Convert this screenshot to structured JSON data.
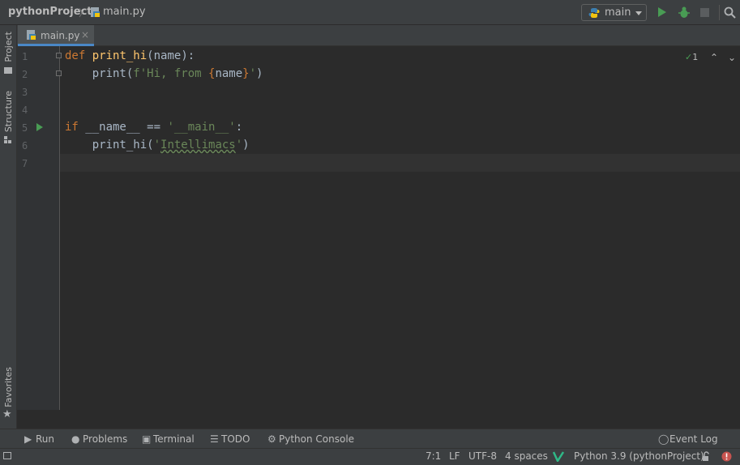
{
  "nav": {
    "project": "pythonProject",
    "file": "main.py",
    "run_config": "main"
  },
  "left_strip": {
    "project": "Project",
    "structure": "Structure",
    "favorites": "Favorites"
  },
  "tabs": [
    {
      "label": "main.py",
      "close": "×"
    }
  ],
  "editor": {
    "line_numbers": [
      "1",
      "2",
      "3",
      "4",
      "5",
      "6",
      "7"
    ],
    "lines": {
      "l1": {
        "kw": "def",
        "fn": "print_hi",
        "rest": "(name):"
      },
      "l2": {
        "indent": "    ",
        "call": "print(",
        "s1": "f'Hi, from ",
        "b1": "{",
        "var": "name",
        "b2": "}",
        "s2": "'",
        "end": ")"
      },
      "l5": {
        "kw": "if",
        "mid": " __name__ == ",
        "str": "'__main__'",
        "end": ":"
      },
      "l6": {
        "indent": "    ",
        "call": "print_hi(",
        "q1": "'",
        "word": "Intellimacs",
        "q2": "'",
        "end": ")"
      }
    },
    "inspection_count": "1"
  },
  "tool_windows": {
    "run": "Run",
    "problems": "Problems",
    "terminal": "Terminal",
    "todo": "TODO",
    "python_console": "Python Console",
    "event_log": "Event Log"
  },
  "status": {
    "position": "7:1",
    "line_sep": "LF",
    "encoding": "UTF-8",
    "indent": "4 spaces",
    "interpreter": "Python 3.9 (pythonProject)"
  },
  "colors": {
    "background": "#2b2b2b",
    "keyword": "#cc7832",
    "function": "#ffc66d",
    "string": "#6a8759",
    "run_green": "#499c54",
    "error_red": "#c75450"
  }
}
